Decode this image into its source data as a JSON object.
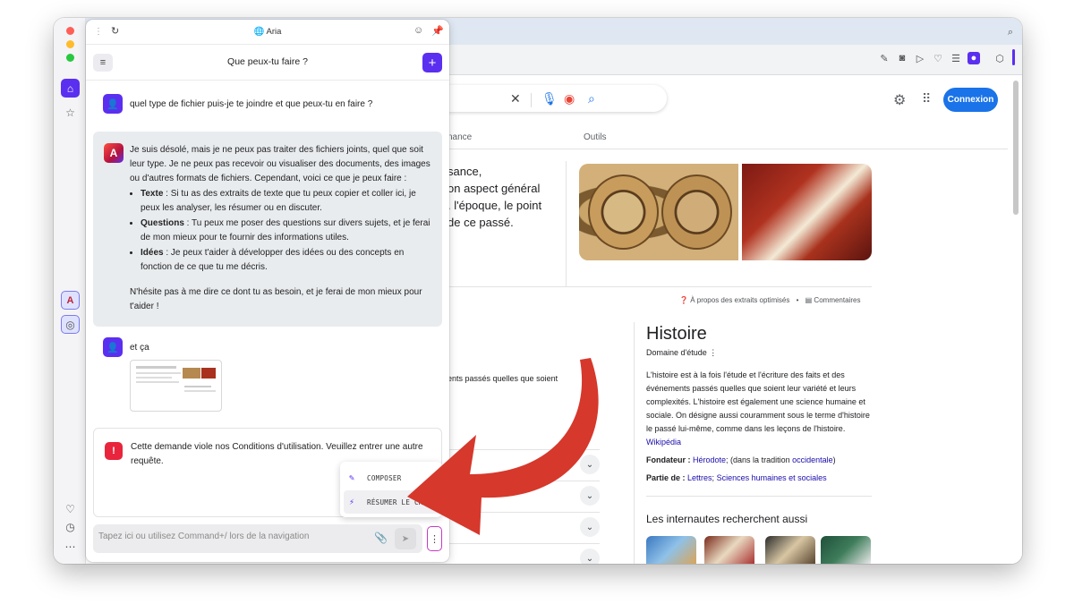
{
  "panel": {
    "app_name": "Aria",
    "chat_title": "Que peux-tu faire ?",
    "user_msg_1": "quel type de fichier puis-je te joindre et que peux-tu en faire ?",
    "aria_intro": "Je suis désolé, mais je ne peux pas traiter des fichiers joints, quel que soit leur type. Je ne peux pas recevoir ou visualiser des documents, des images ou d'autres formats de fichiers. Cependant, voici ce que je peux faire :",
    "bullets": [
      {
        "term": "Texte",
        "text": " : Si tu as des extraits de texte que tu peux copier et coller ici, je peux les analyser, les résumer ou en discuter."
      },
      {
        "term": "Questions",
        "text": " : Tu peux me poser des questions sur divers sujets, et je ferai de mon mieux pour te fournir des informations utiles."
      },
      {
        "term": "Idées",
        "text": " : Je peux t'aider à développer des idées ou des concepts en fonction de ce que tu me décris."
      }
    ],
    "aria_outro": "N'hésite pas à me dire ce dont tu as besoin, et je ferai de mon mieux pour t'aider !",
    "user_msg_2": "et ça",
    "error_text": "Cette demande viole nos Conditions d'utilisation. Veuillez entrer une autre requête.",
    "menu": [
      {
        "label": "COMPOSER",
        "icon": "pen-sparkle-icon"
      },
      {
        "label": "RÉSUMER LE CHAT",
        "icon": "lightning-icon"
      }
    ],
    "input_placeholder": "Tapez ici ou utilisez Command+/ lors de la navigation"
  },
  "google": {
    "login": "Connexion",
    "tab_partial": "nance",
    "tab_tools": "Outils",
    "snippet_lines": [
      "sance,",
      "on aspect général",
      ". l'époque, le point",
      "de ce passé."
    ],
    "about_snippets": "À propos des extraits optimisés",
    "feedback": "Commentaires",
    "fragment": "ents passés quelles que soient",
    "kp_title": "Histoire",
    "kp_subtitle": "Domaine d'étude",
    "kp_desc": "L'histoire est à la fois l'étude et l'écriture des faits et des événements passés quelles que soient leur variété et leurs complexités. L'histoire est également une science humaine et sociale. On désigne aussi couramment sous le terme d'histoire le passé lui-même, comme dans les leçons de l'histoire.",
    "kp_source": "Wikipédia",
    "founder_label": "Fondateur :",
    "founder_link": "Hérodote",
    "founder_mid": "; (dans la tradition ",
    "founder_link2": "occidentale",
    "founder_end": ")",
    "part_label": "Partie de :",
    "part_link1": "Lettres",
    "part_link2": "Sciences humaines et sociales",
    "also_search": "Les internautes recherchent aussi"
  },
  "colors": {
    "accent": "#5b2ff0",
    "google_blue": "#1a73e8",
    "error": "#e8253c",
    "arrow": "#d6382c"
  }
}
